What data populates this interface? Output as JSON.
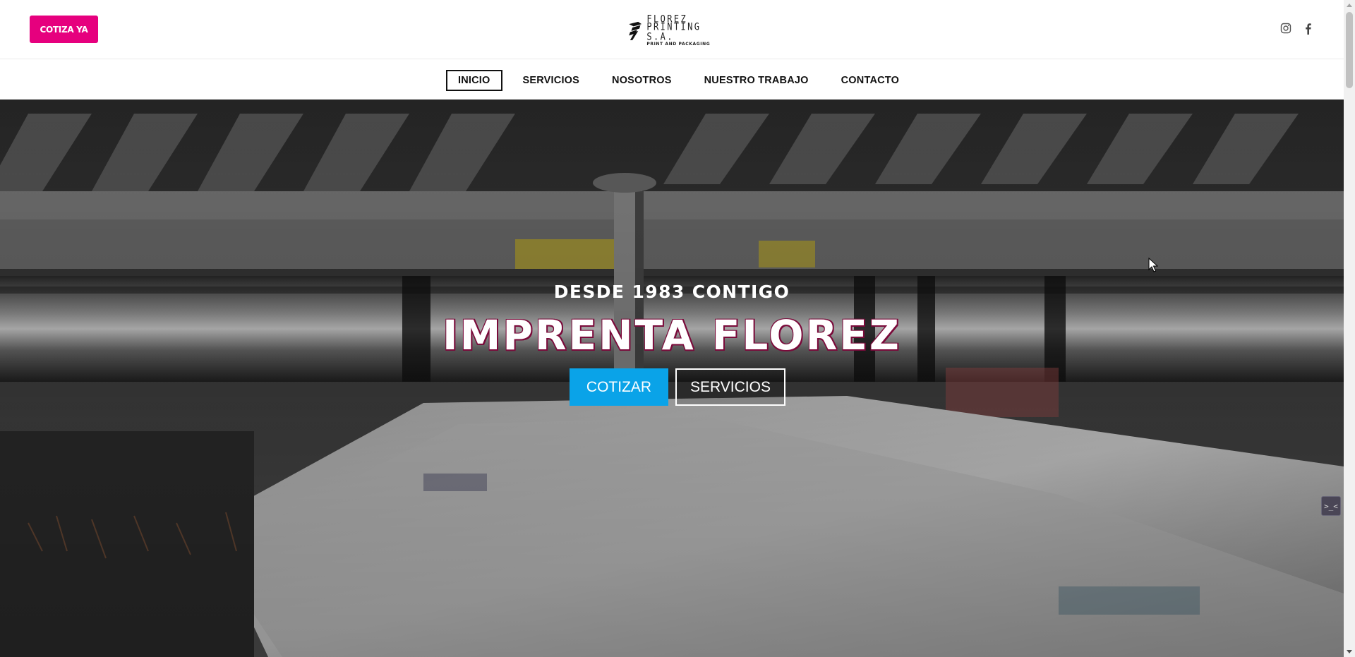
{
  "header": {
    "cta_label": "COTIZA YA",
    "logo": {
      "line1": "FLOREZ",
      "line2": "PRINTING S.A.",
      "tagline": "PRINT AND PACKAGING"
    },
    "social": [
      {
        "icon": "instagram-icon"
      },
      {
        "icon": "facebook-icon"
      }
    ],
    "accent_color": "#e6007e"
  },
  "nav": {
    "items": [
      {
        "label": "INICIO",
        "active": true
      },
      {
        "label": "SERVICIOS"
      },
      {
        "label": "NOSOTROS"
      },
      {
        "label": "NUESTRO TRABAJO"
      },
      {
        "label": "CONTACTO"
      }
    ]
  },
  "hero": {
    "kicker": "DESDE 1983 CONTIGO",
    "title": "IMPRENTA FLOREZ",
    "primary_button": "COTIZAR",
    "secondary_button": "SERVICIOS",
    "primary_color": "#0aa3e8"
  },
  "widget": {
    "label": ">_<"
  }
}
